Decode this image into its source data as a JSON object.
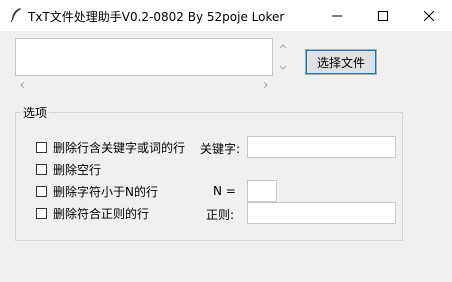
{
  "window": {
    "title": "TxT文件处理助手V0.2-0802 By 52poje Loker",
    "icon": "feather-icon",
    "controls": {
      "minimize": "minimize-icon",
      "maximize": "maximize-icon",
      "close": "close-icon"
    }
  },
  "file_box": {
    "value": ""
  },
  "buttons": {
    "select_file": "选择文件"
  },
  "options": {
    "group_title": "选项",
    "items": [
      {
        "label": "删除行含关键字或词的行",
        "checked": false
      },
      {
        "label": "删除空行",
        "checked": false
      },
      {
        "label": "删除字符小于N的行",
        "checked": false
      },
      {
        "label": "删除符合正则的行",
        "checked": false
      }
    ],
    "keyword_label": "关键字:",
    "keyword_value": "",
    "n_label": "N =",
    "n_value": "",
    "regex_label": "正则:",
    "regex_value": ""
  },
  "colors": {
    "window_bg": "#f0f0f0",
    "titlebar_bg": "#ffffff",
    "focus_accent": "#0078d7"
  }
}
